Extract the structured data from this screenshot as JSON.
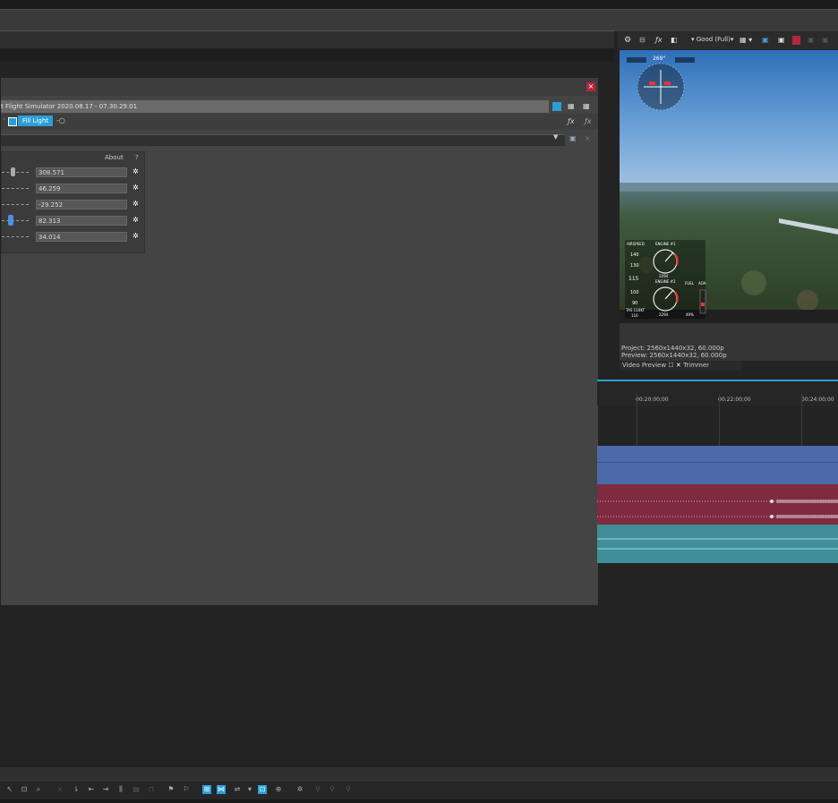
{
  "fx_window": {
    "chain_title": "t Flight Simulator 2020.08.17 - 07.30.29.01",
    "close_label": "×",
    "plugin_chip": "Fill Light",
    "params_about": "About",
    "params_help": "?",
    "params": [
      {
        "value": "308.571"
      },
      {
        "value": "46.259"
      },
      {
        "value": "-29.252"
      },
      {
        "value": "82.313"
      },
      {
        "value": "34.014"
      }
    ]
  },
  "preview": {
    "quality_label": "Good (Full)",
    "project_line": "Project:  2560x1440x32, 60.000p",
    "preview_line": "Preview:  2560x1440x32, 60.000p",
    "tab_video_preview": "Video Preview",
    "tab_trimmer": "Trimmer",
    "hud": {
      "heading": "269°",
      "airspeed_label": "AIRSPEED",
      "engine1_label": "ENGINE #1",
      "engine2_label": "ENGINE #2",
      "fuel_label": "FUEL",
      "aoa_label": "AOA",
      "speed_140": "140",
      "speed_130": "130",
      "speed_115": "115",
      "speed_100": "100",
      "speed_90": "90",
      "rpm_1": "2294",
      "rpm_2": "2294",
      "fuel_pct": "49%",
      "tas": "TAS 116KT",
      "tas_val": "116"
    }
  },
  "timeline": {
    "ticks": [
      "00:20:00;00",
      "00:22:00;00",
      "00:24:00;00"
    ]
  },
  "colors": {
    "accent": "#2a9fd6",
    "video_track": "#4d6aa8",
    "audio_track": "#7e2b3f",
    "audio_track2": "#3e8f99"
  }
}
